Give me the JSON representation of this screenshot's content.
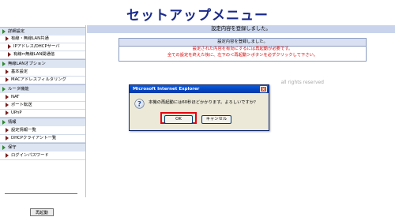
{
  "header": {
    "title": "セットアップメニュー"
  },
  "sidebar": {
    "items": [
      {
        "label": "詳細設定",
        "level": "section"
      },
      {
        "label": "有線・無線LAN共通",
        "level": "sub1"
      },
      {
        "label": "IPアドレス/DHCPサーバ",
        "level": "sub2"
      },
      {
        "label": "有線⇔無線LAN間通信",
        "level": "sub2"
      },
      {
        "label": "無線LANオプション",
        "level": "section"
      },
      {
        "label": "基本設定",
        "level": "sub1"
      },
      {
        "label": "MACアドレスフィルタリング",
        "level": "sub1"
      },
      {
        "label": "ルータ機能",
        "level": "section"
      },
      {
        "label": "NAT",
        "level": "sub1"
      },
      {
        "label": "ポート転送",
        "level": "sub1"
      },
      {
        "label": "UPnP",
        "level": "sub1"
      },
      {
        "label": "情報",
        "level": "section"
      },
      {
        "label": "設定情報一覧",
        "level": "sub1"
      },
      {
        "label": "DHCPクライアント一覧",
        "level": "sub1"
      },
      {
        "label": "保守",
        "level": "section"
      },
      {
        "label": "ログインパスワード",
        "level": "sub1"
      }
    ],
    "restart_label": "再起動"
  },
  "main": {
    "title": "設定内容を登録しました。",
    "notice": {
      "heading": "設定内容を登録しました。",
      "line1": "設定された内容を有効にするには再起動が必要です。",
      "line2": "全ての設定を終えた後に、左下の＜再起動＞ボタンを必ずクリックして下さい。"
    },
    "copyright": "all rights reserved"
  },
  "dialog": {
    "title": "Microsoft Internet Explorer",
    "message": "本機の再起動には60秒ほどかかります。よろしいですか？",
    "ok_label": "OK",
    "cancel_label": "キャンセル",
    "close_label": "×",
    "icon": "question-icon"
  },
  "colors": {
    "header_title": "#1a2a8a",
    "section_bg": "#dde5f3",
    "title_bar_bg": "#c9d4ec",
    "notice_text": "#e00000",
    "highlight": "#e60012",
    "dialog_title_bar": "#0447c2"
  }
}
